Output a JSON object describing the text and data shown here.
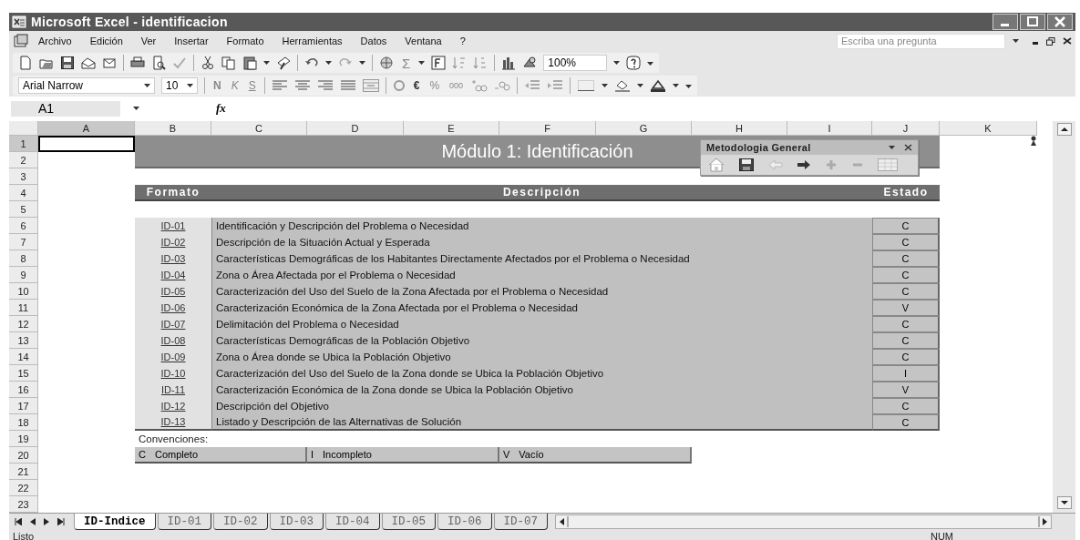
{
  "window": {
    "title": "Microsoft Excel - identificacion"
  },
  "menu_bar": {
    "items": [
      "Archivo",
      "Edición",
      "Ver",
      "Insertar",
      "Formato",
      "Herramientas",
      "Datos",
      "Ventana",
      "?"
    ],
    "help_search": {
      "placeholder": "Escriba una pregunta"
    }
  },
  "standard_toolbar": {
    "autosum": "Σ",
    "zoom": "100%"
  },
  "formatting_toolbar": {
    "font": "Arial Narrow",
    "size": "10",
    "bold": "N",
    "italic": "K",
    "underline": "S",
    "currency": "€",
    "percent": "%",
    "thousands": "000"
  },
  "formula_bar": {
    "name_box": "A1",
    "function_label": "fx"
  },
  "sheet": {
    "columns": [
      "A",
      "B",
      "C",
      "D",
      "E",
      "F",
      "G",
      "H",
      "I",
      "J",
      "K"
    ],
    "rows": [
      "1",
      "2",
      "3",
      "4",
      "5",
      "6",
      "7",
      "8",
      "9",
      "10",
      "11",
      "12",
      "13",
      "14",
      "15",
      "16",
      "17",
      "18",
      "19",
      "20",
      "21",
      "22",
      "23"
    ],
    "title": "Módulo 1: Identificación",
    "headers": [
      "Formato",
      "Descripción",
      "Estado"
    ],
    "items": [
      {
        "code": "ID-01",
        "description": "Identificación y Descripción del Problema o Necesidad",
        "status": "C"
      },
      {
        "code": "ID-02",
        "description": "Descripción de la Situación Actual y Esperada",
        "status": "C"
      },
      {
        "code": "ID-03",
        "description": "Características Demográficas de los Habitantes Directamente Afectados por el Problema o Necesidad",
        "status": "C"
      },
      {
        "code": "ID-04",
        "description": "Zona o Área Afectada por el Problema o Necesidad",
        "status": "C"
      },
      {
        "code": "ID-05",
        "description": "Caracterización del Uso del Suelo de la Zona Afectada por el Problema o Necesidad",
        "status": "C"
      },
      {
        "code": "ID-06",
        "description": "Caracterización Económica de la Zona Afectada por el Problema o Necesidad",
        "status": "V"
      },
      {
        "code": "ID-07",
        "description": "Delimitación del Problema o Necesidad",
        "status": "C"
      },
      {
        "code": "ID-08",
        "description": "Características Demográficas de la Población Objetivo",
        "status": "C"
      },
      {
        "code": "ID-09",
        "description": "Zona o Área donde se Ubica la Población Objetivo",
        "status": "C"
      },
      {
        "code": "ID-10",
        "description": "Caracterización del Uso del Suelo de la Zona donde se Ubica la Población Objetivo",
        "status": "I"
      },
      {
        "code": "ID-11",
        "description": "Caracterización Económica de la Zona donde se Ubica la Población Objetivo",
        "status": "V"
      },
      {
        "code": "ID-12",
        "description": "Descripción del Objetivo",
        "status": "C"
      },
      {
        "code": "ID-13",
        "description": "Listado y Descripción de las Alternativas de Solución",
        "status": "C"
      }
    ],
    "conventions_label": "Convenciones:",
    "conventions": [
      {
        "code": "C",
        "label": "Completo"
      },
      {
        "code": "I",
        "label": "Incompleto"
      },
      {
        "code": "V",
        "label": "Vacío"
      }
    ]
  },
  "floating_toolbar": {
    "title": "Metodologia General"
  },
  "sheet_tabs": [
    {
      "label": "ID-Indice",
      "selected": true
    },
    {
      "label": "ID-01",
      "selected": false
    },
    {
      "label": "ID-02",
      "selected": false
    },
    {
      "label": "ID-03",
      "selected": false
    },
    {
      "label": "ID-04",
      "selected": false
    },
    {
      "label": "ID-05",
      "selected": false
    },
    {
      "label": "ID-06",
      "selected": false
    },
    {
      "label": "ID-07",
      "selected": false
    }
  ],
  "status_bar": {
    "status": "Listo",
    "indicator": "NUM"
  }
}
